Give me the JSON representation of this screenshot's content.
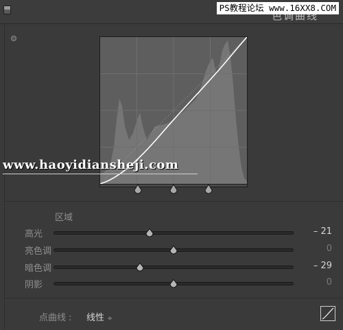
{
  "header": {
    "title": "色调曲线",
    "watermark": "PS教程论坛 www.16XX8.COM"
  },
  "graph": {
    "watermark": "www.haoyidiansheji.com",
    "split_points": [
      0.25,
      0.5,
      0.75
    ]
  },
  "region": {
    "label": "区域",
    "sliders": [
      {
        "label": "高光",
        "value": "– 21",
        "position": 0.4
      },
      {
        "label": "亮色调",
        "value": "0",
        "position": 0.5
      },
      {
        "label": "暗色调",
        "value": "– 29",
        "position": 0.36
      },
      {
        "label": "阴影",
        "value": "0",
        "position": 0.5
      }
    ]
  },
  "point_curve": {
    "label": "点曲线 :",
    "value": "线性",
    "arrow": "÷"
  },
  "colors": {
    "panel": "#3a3a3a",
    "graph_bg": "#5e5e5e",
    "histogram": "#767676",
    "curve": "#ffffff"
  },
  "icons": {
    "collapse": "square-toggle-icon",
    "target": "target-adjust-icon",
    "handle": "triangle-handle-icon",
    "curve_button": "curve-edit-icon"
  }
}
